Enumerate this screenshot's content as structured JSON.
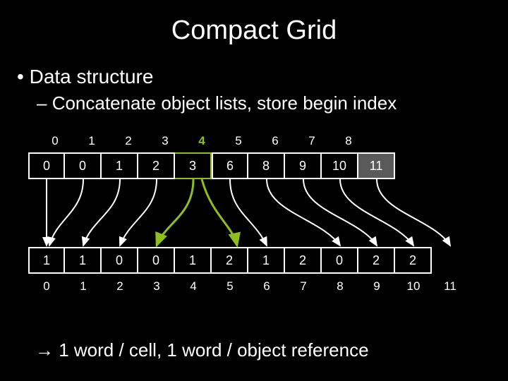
{
  "title": "Compact Grid",
  "bullet1": "Data structure",
  "bullet2": "Concatenate object lists, store begin index",
  "conclusion_arrow": "→",
  "conclusion": " 1 word / cell, 1 word / object reference",
  "top_indices": [
    "0",
    "1",
    "2",
    "3",
    "4",
    "5",
    "6",
    "7",
    "8"
  ],
  "top_highlight_index": 4,
  "row1_cells": [
    "0",
    "0",
    "1",
    "2",
    "3",
    "6",
    "8",
    "9",
    "10",
    "11"
  ],
  "row1_highlight_col": 4,
  "row1_shaded_col": 9,
  "row2_cells": [
    "1",
    "1",
    "0",
    "0",
    "1",
    "2",
    "1",
    "2",
    "0",
    "2",
    "2"
  ],
  "bottom_indices": [
    "0",
    "1",
    "2",
    "3",
    "4",
    "5",
    "6",
    "7",
    "8",
    "9",
    "10",
    "11"
  ],
  "chart_data": {
    "type": "diagram",
    "description": "Compact grid data structure: begin-index array (offsets) with arrows into concatenated object-reference array.",
    "begin_index_array": [
      0,
      0,
      1,
      2,
      3,
      6,
      8,
      9,
      10,
      11
    ],
    "object_reference_array": [
      1,
      1,
      0,
      0,
      1,
      2,
      1,
      2,
      0,
      2,
      2
    ],
    "cell_index_labels": [
      0,
      1,
      2,
      3,
      4,
      5,
      6,
      7,
      8
    ],
    "object_index_labels": [
      0,
      1,
      2,
      3,
      4,
      5,
      6,
      7,
      8,
      9,
      10,
      11
    ],
    "highlighted_cell_index": 4,
    "arrow_mapping_begin_to_objects": [
      {
        "from_cell": 0,
        "to_object": 0
      },
      {
        "from_cell": 1,
        "to_object": 0
      },
      {
        "from_cell": 2,
        "to_object": 1
      },
      {
        "from_cell": 3,
        "to_object": 2
      },
      {
        "from_cell": 4,
        "to_object": 3,
        "highlighted": true,
        "span_end": 5
      },
      {
        "from_cell": 5,
        "to_object": 6
      },
      {
        "from_cell": 6,
        "to_object": 8
      },
      {
        "from_cell": 7,
        "to_object": 9
      },
      {
        "from_cell": 8,
        "to_object": 10
      },
      {
        "from_cell": 9,
        "to_object": 11,
        "sentinel": true
      }
    ]
  }
}
